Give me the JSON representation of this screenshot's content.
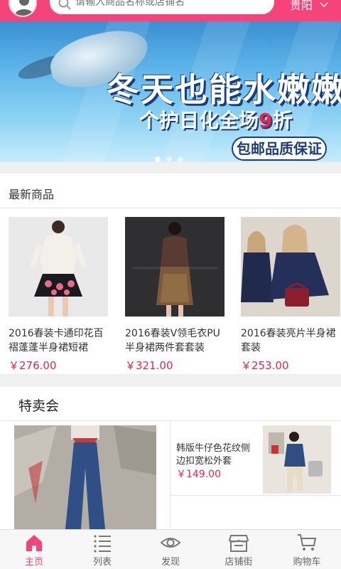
{
  "header": {
    "search_placeholder": "请输入商品名称或店铺名",
    "city": "贵阳"
  },
  "banner": {
    "title": "冬天也能水嫩嫩",
    "subtitle_prefix": "个护日化全场",
    "subtitle_number": "9",
    "subtitle_suffix": "折",
    "badge": "包邮品质保证",
    "slides": 3,
    "active_slide": 1
  },
  "newest": {
    "title": "最新商品",
    "products": [
      {
        "name": "2016春装卡通印花百褶蓬蓬半身裙短裙",
        "price": "￥276.00"
      },
      {
        "name": "2016春装V领毛衣PU半身裙两件套套装",
        "price": "￥321.00"
      },
      {
        "name": "2016春装亮片半身裙套装",
        "price": "￥253.00"
      }
    ]
  },
  "sale": {
    "title": "特卖会",
    "item": {
      "name": "韩版牛仔色花纹侧边扣宽松外套",
      "price": "￥149.00"
    }
  },
  "tabs": [
    {
      "label": "主页",
      "icon": "home-icon"
    },
    {
      "label": "列表",
      "icon": "list-icon"
    },
    {
      "label": "发现",
      "icon": "eye-icon"
    },
    {
      "label": "店铺街",
      "icon": "store-icon"
    },
    {
      "label": "购物车",
      "icon": "cart-icon"
    }
  ],
  "colors": {
    "accent": "#f4447a",
    "price": "#e8264c"
  }
}
